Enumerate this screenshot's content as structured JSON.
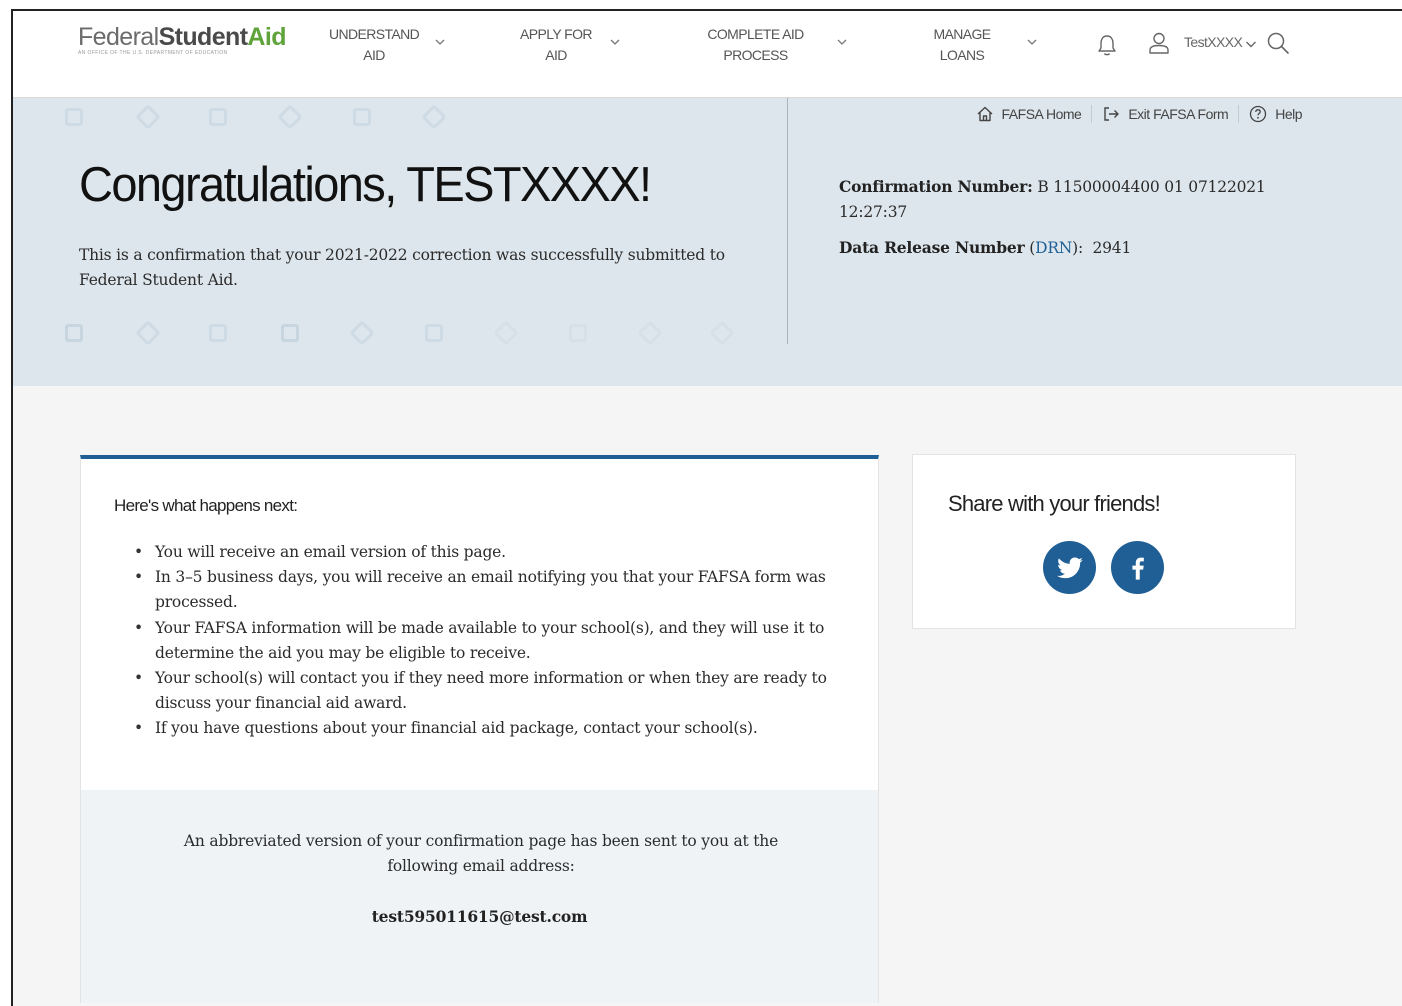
{
  "logo": {
    "federal": "Federal",
    "student": "Student",
    "aid": "Aid",
    "tagline": "An OFFICE of the U.S. DEPARTMENT of EDUCATION"
  },
  "nav": {
    "items": [
      {
        "label": "UNDERSTAND AID"
      },
      {
        "label": "APPLY FOR AID"
      },
      {
        "label": "COMPLETE AID PROCESS"
      },
      {
        "label": "MANAGE LOANS"
      }
    ],
    "username": "TestXXXX"
  },
  "utility": {
    "home": "FAFSA Home",
    "exit": "Exit FAFSA Form",
    "help": "Help"
  },
  "hero": {
    "title": "Congratulations, TESTXXXX!",
    "subtitle": "This is a confirmation that your 2021-2022 correction was successfully submitted to Federal Student Aid.",
    "confirmation_label": "Confirmation Number:",
    "confirmation_value": "B 11500004400 01 07122021 12:27:37",
    "drn_label": "Data Release Number",
    "drn_abbr": "DRN",
    "drn_value": "2941"
  },
  "next_steps": {
    "heading": "Here's what happens next:",
    "items": [
      "You will receive an email version of this page.",
      "In 3–5 business days, you will receive an email notifying you that your FAFSA form was processed.",
      "Your FAFSA information will be made available to your school(s), and they will use it to determine the aid you may be eligible to receive.",
      "Your school(s) will contact you if they need more information or when they are ready to discuss your financial aid award.",
      "If you have questions about your financial aid package, contact your school(s)."
    ],
    "email_note": "An abbreviated version of your confirmation page has been sent to you at the following email address:",
    "email": "test595011615@test.com"
  },
  "share": {
    "heading": "Share with your friends!",
    "icons": [
      "twitter-icon",
      "facebook-icon"
    ]
  },
  "colors": {
    "brand_blue": "#1f5f95",
    "brand_green": "#5fa33a",
    "hero_bg": "#dde6ec"
  }
}
